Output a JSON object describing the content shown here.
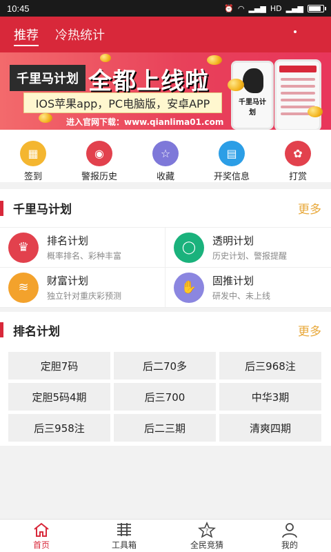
{
  "status_bar": {
    "time": "10:45",
    "network": "HD"
  },
  "top_nav": {
    "tabs": [
      "推荐",
      "冷热统计"
    ]
  },
  "banner": {
    "brand": "千里马计划",
    "headline": "全都上线啦",
    "platforms": "IOS苹果app，PC电脑版，安卓APP",
    "url_text": "进入官网下载：www.qianlima01.com",
    "phone_brand": "千里马计划"
  },
  "quick_actions": [
    {
      "label": "签到",
      "icon": "calendar-icon",
      "color": "#f4b630"
    },
    {
      "label": "警报历史",
      "icon": "alarm-icon",
      "color": "#e2414d"
    },
    {
      "label": "收藏",
      "icon": "star-icon",
      "color": "#7e78d9"
    },
    {
      "label": "开奖信息",
      "icon": "info-icon",
      "color": "#2c9ee6"
    },
    {
      "label": "打赏",
      "icon": "gift-icon",
      "color": "#e2414d"
    }
  ],
  "section_plans": {
    "title": "千里马计划",
    "more": "更多",
    "items": [
      {
        "name": "排名计划",
        "desc": "概率排名、彩种丰富",
        "icon": "trophy-icon",
        "color": "#e2414d"
      },
      {
        "name": "透明计划",
        "desc": "历史计划、警报提醒",
        "icon": "chat-icon",
        "color": "#1ab27c"
      },
      {
        "name": "财富计划",
        "desc": "独立针对重庆彩预测",
        "icon": "coins-icon",
        "color": "#f3a22c"
      },
      {
        "name": "固推计划",
        "desc": "研发中、未上线",
        "icon": "hand-icon",
        "color": "#8b86e0"
      }
    ]
  },
  "section_ranking": {
    "title": "排名计划",
    "more": "更多",
    "tags": [
      "定胆7码",
      "后二70多",
      "后三968注",
      "定胆5码4期",
      "后三700",
      "中华3期",
      "后三958注",
      "后二三期",
      "清爽四期"
    ]
  },
  "bottom_nav": [
    {
      "label": "首页",
      "icon": "home-icon"
    },
    {
      "label": "工具箱",
      "icon": "toolbox-icon"
    },
    {
      "label": "全民竞猜",
      "icon": "star-question-icon"
    },
    {
      "label": "我的",
      "icon": "user-icon"
    }
  ]
}
